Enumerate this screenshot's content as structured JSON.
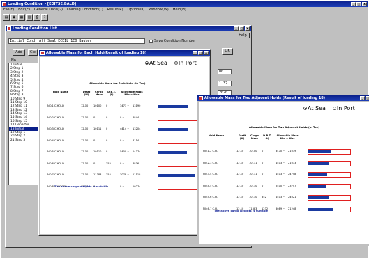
{
  "app": {
    "title": "Loading Condition - [EDITSE:BALD]",
    "menu": [
      "File(F)",
      "Edit(E)",
      "General Data(G)",
      "Loading Condition(L)",
      "Result(R)",
      "Option(O)",
      "Window(W)",
      "Help(H)"
    ],
    "toolbar_icons": [
      "open-icon",
      "save-icon",
      "grid-icon",
      "table-icon",
      "print-icon",
      "help-icon"
    ]
  },
  "list_win": {
    "title": "Loading Condition List",
    "cond_name": "Initial Cond. Aft Seal ECEIL 1CO Bauker",
    "check_label": "Save Condition Number",
    "help_btn": "Help",
    "btns": [
      "Add",
      "Cle"
    ],
    "ok": "OK",
    "col_no": "No.",
    "items": [
      "1 Initial",
      "2 Step 1",
      "3 Step 2",
      "4 Step 3",
      "5 Step 4",
      "6 Step 5",
      "7 Step 6",
      "8 Step 7",
      "9 Step 8",
      "10 Step 9",
      "11 Step 10",
      "12 Step 11",
      "13 Step 12",
      "14 Step 13",
      "15 Step 14",
      "16 Step 15",
      "17 Departur",
      "18 Initial",
      "19 Step 1",
      "20 Step 2",
      "21 Step 3"
    ],
    "selected": 17,
    "right_vals": [
      "00.",
      "1.32",
      "2020",
      "2.818"
    ]
  },
  "w1": {
    "title": "Allowable Mass for Each Hold(Result of loading 18)",
    "radio_sea": "At Sea",
    "radio_port": "In Port",
    "table_title": "Allowable Mass for Each Hold (in Ton)",
    "headers": [
      "Hold Name",
      "Draft (M)",
      "Cargo Mass",
      "D.B.T. (t)",
      "Allowable Mass Min ~ Max"
    ],
    "rows": [
      [
        "NO.1 C.HOLD",
        "12.10",
        "10100",
        "0",
        "3471 ~",
        "13190"
      ],
      [
        "NO.2 C.HOLD",
        "12.10",
        "0",
        "0",
        "0 ~",
        "8844"
      ],
      [
        "NO.3 C.HOLD",
        "12.10",
        "10111",
        "0",
        "4414 ~",
        "13204"
      ],
      [
        "NO.4 C.HOLD",
        "12.10",
        "0",
        "0",
        "0 ~",
        "8114"
      ],
      [
        "NO.5 C.HOLD",
        "12.10",
        "10110",
        "0",
        "5400 ~",
        "14374"
      ],
      [
        "NO.6 C.HOLD",
        "12.10",
        "0",
        "352",
        "0 ~",
        "8836"
      ],
      [
        "NO.7 C.HOLD",
        "12.10",
        "11383",
        "355",
        "3078 ~",
        "11518"
      ],
      [
        "NO.8 C.H.DOEP",
        "12.10",
        "0",
        "0",
        "0 ~",
        "10274"
      ]
    ],
    "bars": [
      0.72,
      0,
      0.74,
      0,
      0.7,
      0,
      0.9,
      0
    ],
    "note": "The above cargo weights is suitable"
  },
  "w2": {
    "title": "Allowable Mass for Two Adjacent Holds (Result of loading 18)",
    "radio_sea": "At Sea",
    "radio_port": "In Port",
    "table_title": "Allowable Mass for Two Adjacent Holds (in Ton)",
    "headers": [
      "Hold Name",
      "Draft (M)",
      "Cargo Mass",
      "D.B.T. (t)",
      "Allowable Mass Min ~ Max"
    ],
    "rows": [
      [
        "NO.1-2 C.H.",
        "12.10",
        "10100",
        "0",
        "3470 ~",
        "21039"
      ],
      [
        "NO.2-3 C.H.",
        "12.10",
        "10111",
        "0",
        "4403 ~",
        "21033"
      ],
      [
        "NO.3-4 C.H.",
        "12.10",
        "10111",
        "0",
        "4403 ~",
        "24748"
      ],
      [
        "NO.4-5 C.H.",
        "12.10",
        "10110",
        "0",
        "5400 ~",
        "23747"
      ],
      [
        "NO.5-6 C.H.",
        "12.10",
        "10110",
        "352",
        "4403 ~",
        "24021"
      ],
      [
        "NO.6-7 C.H.",
        "12.10",
        "11383",
        "1232",
        "3089 ~",
        "21248"
      ]
    ],
    "bars": [
      0.55,
      0.5,
      0.45,
      0.42,
      0.5,
      0.6
    ],
    "note": "The above cargo weights is suitable"
  },
  "colors": {
    "title_bar": "#0a1f8a",
    "bar_fill": "#1a3aa0",
    "bar_outline": "#e02020"
  }
}
